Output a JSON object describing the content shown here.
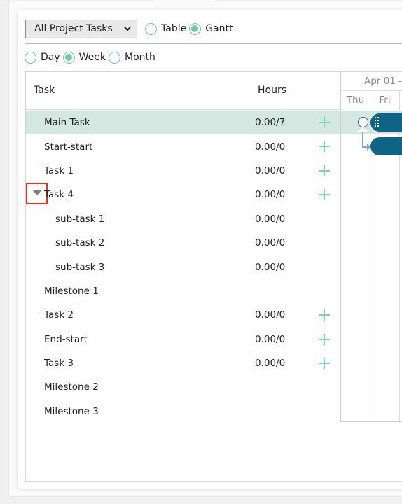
{
  "toolbar": {
    "filter_select": {
      "value": "All Project Tasks"
    },
    "view_options": [
      {
        "label": "Table",
        "checked": false
      },
      {
        "label": "Gantt",
        "checked": true
      }
    ]
  },
  "scale_options": [
    {
      "label": "Day",
      "checked": false
    },
    {
      "label": "Week",
      "checked": true
    },
    {
      "label": "Month",
      "checked": false
    }
  ],
  "grid": {
    "columns": {
      "task": "Task",
      "hours": "Hours"
    },
    "rows": [
      {
        "name": "Main Task",
        "hours": "0.00/7",
        "add": true,
        "selected": true,
        "level": 0
      },
      {
        "name": "Start-start",
        "hours": "0.00/0",
        "add": true,
        "level": 0
      },
      {
        "name": "Task 1",
        "hours": "0.00/0",
        "add": true,
        "level": 0
      },
      {
        "name": "Task 4",
        "hours": "0.00/0",
        "add": true,
        "level": 0,
        "expanded": true
      },
      {
        "name": "sub-task 1",
        "hours": "0.00/0",
        "add": false,
        "level": 1
      },
      {
        "name": "sub-task 2",
        "hours": "0.00/0",
        "add": false,
        "level": 1
      },
      {
        "name": "sub-task 3",
        "hours": "0.00/0",
        "add": false,
        "level": 1
      },
      {
        "name": "Milestone 1",
        "hours": "",
        "add": false,
        "level": 0
      },
      {
        "name": "Task 2",
        "hours": "0.00/0",
        "add": true,
        "level": 0
      },
      {
        "name": "End-start",
        "hours": "0.00/0",
        "add": true,
        "level": 0
      },
      {
        "name": "Task 3",
        "hours": "0.00/0",
        "add": true,
        "level": 0
      },
      {
        "name": "Milestone 2",
        "hours": "",
        "add": false,
        "level": 0
      },
      {
        "name": "Milestone 3",
        "hours": "",
        "add": false,
        "level": 0
      }
    ]
  },
  "gantt": {
    "week_label": "Apr 01 -",
    "days": [
      "Thu",
      "Fri"
    ],
    "colors": {
      "bar": "#0e6484",
      "accent": "#6fc7a3",
      "selected_row": "#d5e7e1",
      "highlight": "#e8321f"
    }
  }
}
